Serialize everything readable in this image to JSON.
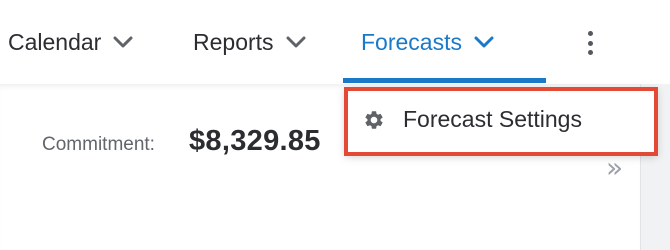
{
  "nav": {
    "items": [
      {
        "label": "Calendar",
        "icon": "chevron-down-icon",
        "active": false
      },
      {
        "label": "Reports",
        "icon": "chevron-down-icon",
        "active": false
      },
      {
        "label": "Forecasts",
        "icon": "chevron-down-icon",
        "active": true
      }
    ],
    "more_icon": "more-vertical-icon"
  },
  "content": {
    "commitment_label": "Commitment:",
    "commitment_value": "$8,329.85",
    "expand_icon": "double-chevron-right-icon",
    "expand_glyph": "»"
  },
  "dropdown": {
    "items": [
      {
        "label": "Forecast Settings",
        "icon": "gear-icon"
      }
    ]
  },
  "colors": {
    "accent": "#1a7ac9",
    "highlight": "#e34a35",
    "text": "#2b2d31",
    "muted": "#62666c"
  }
}
